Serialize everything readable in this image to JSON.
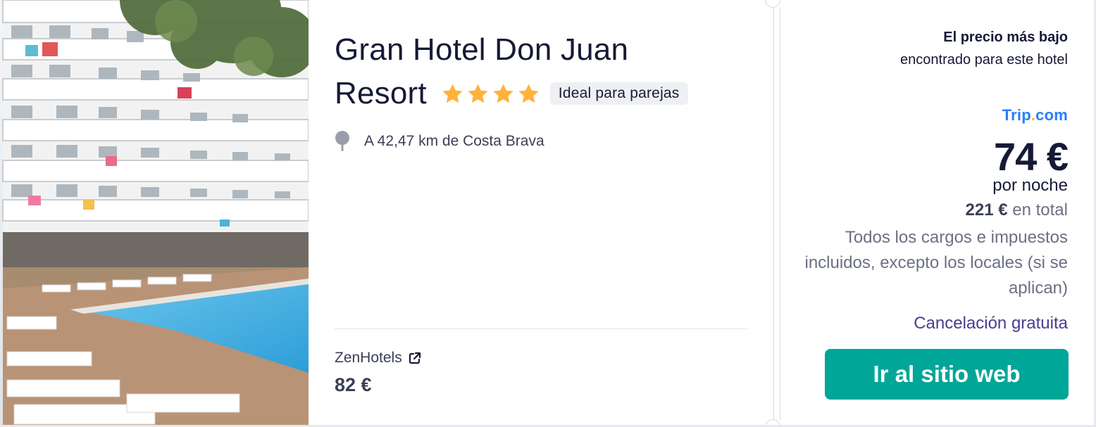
{
  "hotel": {
    "name_line1": "Gran Hotel Don Juan",
    "name_line2": "Resort",
    "star_count": 4,
    "tag": "Ideal para parejas",
    "location": "A 42,47 km de Costa Brava",
    "photo_alt": "hotel-pool-facade-photo"
  },
  "alternate_offer": {
    "provider": "ZenHotels",
    "price": "82 €",
    "icon": "external-link-icon"
  },
  "best_offer": {
    "title": "El precio más bajo",
    "subtitle": "encontrado para este hotel",
    "provider_logo_main": "Trip",
    "provider_logo_dot": ".",
    "provider_logo_end": "com",
    "price": "74 €",
    "per_night": "por noche",
    "total_amount": "221 €",
    "total_suffix": " en total",
    "taxes_note": "Todos los cargos e impuestos incluidos, excepto los locales (si se aplican)",
    "cancellation": "Cancelación gratuita",
    "cta_label": "Ir al sitio web"
  },
  "colors": {
    "accent_button": "#00a698",
    "star": "#ffb23a",
    "cancellation": "#4b3c8f",
    "trip_blue": "#287dfa"
  }
}
